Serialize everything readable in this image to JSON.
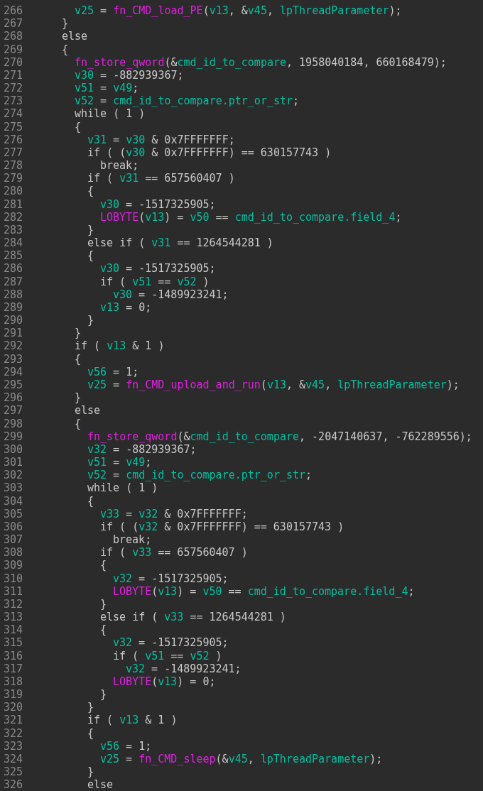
{
  "code_view": {
    "continued_block_lines": [
      {
        "number": "266",
        "tokens": [
          {
            "kind": "var",
            "text": "v25"
          },
          {
            "kind": "plain",
            "text": " = "
          },
          {
            "kind": "func",
            "text": "fn_CMD_load_PE"
          },
          {
            "kind": "plain",
            "text": "("
          },
          {
            "kind": "var",
            "text": "v13"
          },
          {
            "kind": "plain",
            "text": ", &"
          },
          {
            "kind": "var",
            "text": "v45"
          },
          {
            "kind": "plain",
            "text": ", "
          },
          {
            "kind": "var",
            "text": "lpThreadParameter"
          },
          {
            "kind": "plain",
            "text": ");"
          }
        ]
      }
    ],
    "lines": [
      {
        "number": "267",
        "tokens": [
          {
            "kind": "plain",
            "text": "}"
          }
        ]
      },
      {
        "number": "268",
        "tokens": [
          {
            "kind": "plain",
            "text": "else"
          }
        ]
      },
      {
        "number": "269",
        "tokens": [
          {
            "kind": "plain",
            "text": "{"
          }
        ],
        "children": [
          {
            "number": "270",
            "tokens": [
              {
                "kind": "func",
                "text": "fn_store_qword"
              },
              {
                "kind": "plain",
                "text": "(&"
              },
              {
                "kind": "var",
                "text": "cmd_id_to_compare"
              },
              {
                "kind": "plain",
                "text": ", 1958040184, 660168479);"
              }
            ]
          },
          {
            "number": "271",
            "tokens": [
              {
                "kind": "var",
                "text": "v30"
              },
              {
                "kind": "plain",
                "text": " = -882939367;"
              }
            ]
          },
          {
            "number": "272",
            "tokens": [
              {
                "kind": "var",
                "text": "v51"
              },
              {
                "kind": "plain",
                "text": " = "
              },
              {
                "kind": "var",
                "text": "v49"
              },
              {
                "kind": "plain",
                "text": ";"
              }
            ]
          },
          {
            "number": "273",
            "tokens": [
              {
                "kind": "var",
                "text": "v52"
              },
              {
                "kind": "plain",
                "text": " = "
              },
              {
                "kind": "var",
                "text": "cmd_id_to_compare.ptr_or_str"
              },
              {
                "kind": "plain",
                "text": ";"
              }
            ]
          },
          {
            "number": "274",
            "tokens": [
              {
                "kind": "plain",
                "text": "while ( 1 )"
              }
            ]
          },
          {
            "number": "275",
            "tokens": [
              {
                "kind": "plain",
                "text": "{"
              }
            ],
            "children": [
              {
                "number": "276",
                "tokens": [
                  {
                    "kind": "var",
                    "text": "v31"
                  },
                  {
                    "kind": "plain",
                    "text": " = "
                  },
                  {
                    "kind": "var",
                    "text": "v30"
                  },
                  {
                    "kind": "plain",
                    "text": " & 0x7FFFFFFF;"
                  }
                ]
              },
              {
                "number": "277",
                "tokens": [
                  {
                    "kind": "plain",
                    "text": "if ( ("
                  },
                  {
                    "kind": "var",
                    "text": "v30"
                  },
                  {
                    "kind": "plain",
                    "text": " & 0x7FFFFFFF) == 630157743 )"
                  }
                ],
                "children": [
                  {
                    "number": "278",
                    "tokens": [
                      {
                        "kind": "plain",
                        "text": "break;"
                      }
                    ]
                  }
                ]
              },
              {
                "number": "279",
                "tokens": [
                  {
                    "kind": "plain",
                    "text": "if ( "
                  },
                  {
                    "kind": "var",
                    "text": "v31"
                  },
                  {
                    "kind": "plain",
                    "text": " == 657560407 )"
                  }
                ]
              },
              {
                "number": "280",
                "tokens": [
                  {
                    "kind": "plain",
                    "text": "{"
                  }
                ],
                "children": [
                  {
                    "number": "281",
                    "tokens": [
                      {
                        "kind": "var",
                        "text": "v30"
                      },
                      {
                        "kind": "plain",
                        "text": " = -1517325905;"
                      }
                    ]
                  },
                  {
                    "number": "282",
                    "tokens": [
                      {
                        "kind": "func",
                        "text": "LOBYTE"
                      },
                      {
                        "kind": "plain",
                        "text": "("
                      },
                      {
                        "kind": "var",
                        "text": "v13"
                      },
                      {
                        "kind": "plain",
                        "text": ") = "
                      },
                      {
                        "kind": "var",
                        "text": "v50"
                      },
                      {
                        "kind": "plain",
                        "text": " == "
                      },
                      {
                        "kind": "var",
                        "text": "cmd_id_to_compare.field_4"
                      },
                      {
                        "kind": "plain",
                        "text": ";"
                      }
                    ]
                  }
                ]
              },
              {
                "number": "283",
                "tokens": [
                  {
                    "kind": "plain",
                    "text": "}"
                  }
                ]
              },
              {
                "number": "284",
                "tokens": [
                  {
                    "kind": "plain",
                    "text": "else if ( "
                  },
                  {
                    "kind": "var",
                    "text": "v31"
                  },
                  {
                    "kind": "plain",
                    "text": " == 1264544281 )"
                  }
                ]
              },
              {
                "number": "285",
                "tokens": [
                  {
                    "kind": "plain",
                    "text": "{"
                  }
                ],
                "children": [
                  {
                    "number": "286",
                    "tokens": [
                      {
                        "kind": "var",
                        "text": "v30"
                      },
                      {
                        "kind": "plain",
                        "text": " = -1517325905;"
                      }
                    ]
                  },
                  {
                    "number": "287",
                    "tokens": [
                      {
                        "kind": "plain",
                        "text": "if ( "
                      },
                      {
                        "kind": "var",
                        "text": "v51"
                      },
                      {
                        "kind": "plain",
                        "text": " == "
                      },
                      {
                        "kind": "var",
                        "text": "v52"
                      },
                      {
                        "kind": "plain",
                        "text": " )"
                      }
                    ],
                    "children": [
                      {
                        "number": "288",
                        "tokens": [
                          {
                            "kind": "var",
                            "text": "v30"
                          },
                          {
                            "kind": "plain",
                            "text": " = -1489923241;"
                          }
                        ]
                      }
                    ]
                  },
                  {
                    "number": "289",
                    "tokens": [
                      {
                        "kind": "var",
                        "text": "v13"
                      },
                      {
                        "kind": "plain",
                        "text": " = 0;"
                      }
                    ]
                  }
                ]
              },
              {
                "number": "290",
                "tokens": [
                  {
                    "kind": "plain",
                    "text": "}"
                  }
                ]
              }
            ]
          },
          {
            "number": "291",
            "tokens": [
              {
                "kind": "plain",
                "text": "}"
              }
            ]
          },
          {
            "number": "292",
            "tokens": [
              {
                "kind": "plain",
                "text": "if ( "
              },
              {
                "kind": "var",
                "text": "v13"
              },
              {
                "kind": "plain",
                "text": " & 1 )"
              }
            ]
          },
          {
            "number": "293",
            "tokens": [
              {
                "kind": "plain",
                "text": "{"
              }
            ],
            "children": [
              {
                "number": "294",
                "tokens": [
                  {
                    "kind": "var",
                    "text": "v56"
                  },
                  {
                    "kind": "plain",
                    "text": " = 1;"
                  }
                ]
              },
              {
                "number": "295",
                "tokens": [
                  {
                    "kind": "var",
                    "text": "v25"
                  },
                  {
                    "kind": "plain",
                    "text": " = "
                  },
                  {
                    "kind": "func",
                    "text": "fn_CMD_upload_and_run"
                  },
                  {
                    "kind": "plain",
                    "text": "("
                  },
                  {
                    "kind": "var",
                    "text": "v13"
                  },
                  {
                    "kind": "plain",
                    "text": ", &"
                  },
                  {
                    "kind": "var",
                    "text": "v45"
                  },
                  {
                    "kind": "plain",
                    "text": ", "
                  },
                  {
                    "kind": "var",
                    "text": "lpThreadParameter"
                  },
                  {
                    "kind": "plain",
                    "text": ");"
                  }
                ]
              }
            ]
          },
          {
            "number": "296",
            "tokens": [
              {
                "kind": "plain",
                "text": "}"
              }
            ]
          },
          {
            "number": "297",
            "tokens": [
              {
                "kind": "plain",
                "text": "else"
              }
            ]
          },
          {
            "number": "298",
            "tokens": [
              {
                "kind": "plain",
                "text": "{"
              }
            ],
            "children": [
              {
                "number": "299",
                "tokens": [
                  {
                    "kind": "func",
                    "text": "fn_store_qword"
                  },
                  {
                    "kind": "plain",
                    "text": "(&"
                  },
                  {
                    "kind": "var",
                    "text": "cmd_id_to_compare"
                  },
                  {
                    "kind": "plain",
                    "text": ", -2047140637, -762289556);"
                  }
                ]
              },
              {
                "number": "300",
                "tokens": [
                  {
                    "kind": "var",
                    "text": "v32"
                  },
                  {
                    "kind": "plain",
                    "text": " = -882939367;"
                  }
                ]
              },
              {
                "number": "301",
                "tokens": [
                  {
                    "kind": "var",
                    "text": "v51"
                  },
                  {
                    "kind": "plain",
                    "text": " = "
                  },
                  {
                    "kind": "var",
                    "text": "v49"
                  },
                  {
                    "kind": "plain",
                    "text": ";"
                  }
                ]
              },
              {
                "number": "302",
                "tokens": [
                  {
                    "kind": "var",
                    "text": "v52"
                  },
                  {
                    "kind": "plain",
                    "text": " = "
                  },
                  {
                    "kind": "var",
                    "text": "cmd_id_to_compare.ptr_or_str"
                  },
                  {
                    "kind": "plain",
                    "text": ";"
                  }
                ]
              },
              {
                "number": "303",
                "tokens": [
                  {
                    "kind": "plain",
                    "text": "while ( 1 )"
                  }
                ]
              },
              {
                "number": "304",
                "tokens": [
                  {
                    "kind": "plain",
                    "text": "{"
                  }
                ],
                "children": [
                  {
                    "number": "305",
                    "tokens": [
                      {
                        "kind": "var",
                        "text": "v33"
                      },
                      {
                        "kind": "plain",
                        "text": " = "
                      },
                      {
                        "kind": "var",
                        "text": "v32"
                      },
                      {
                        "kind": "plain",
                        "text": " & 0x7FFFFFFF;"
                      }
                    ]
                  },
                  {
                    "number": "306",
                    "tokens": [
                      {
                        "kind": "plain",
                        "text": "if ( ("
                      },
                      {
                        "kind": "var",
                        "text": "v32"
                      },
                      {
                        "kind": "plain",
                        "text": " & 0x7FFFFFFF) == 630157743 )"
                      }
                    ],
                    "children": [
                      {
                        "number": "307",
                        "tokens": [
                          {
                            "kind": "plain",
                            "text": "break;"
                          }
                        ]
                      }
                    ]
                  },
                  {
                    "number": "308",
                    "tokens": [
                      {
                        "kind": "plain",
                        "text": "if ( "
                      },
                      {
                        "kind": "var",
                        "text": "v33"
                      },
                      {
                        "kind": "plain",
                        "text": " == 657560407 )"
                      }
                    ]
                  },
                  {
                    "number": "309",
                    "tokens": [
                      {
                        "kind": "plain",
                        "text": "{"
                      }
                    ],
                    "children": [
                      {
                        "number": "310",
                        "tokens": [
                          {
                            "kind": "var",
                            "text": "v32"
                          },
                          {
                            "kind": "plain",
                            "text": " = -1517325905;"
                          }
                        ]
                      },
                      {
                        "number": "311",
                        "tokens": [
                          {
                            "kind": "func",
                            "text": "LOBYTE"
                          },
                          {
                            "kind": "plain",
                            "text": "("
                          },
                          {
                            "kind": "var",
                            "text": "v13"
                          },
                          {
                            "kind": "plain",
                            "text": ") = "
                          },
                          {
                            "kind": "var",
                            "text": "v50"
                          },
                          {
                            "kind": "plain",
                            "text": " == "
                          },
                          {
                            "kind": "var",
                            "text": "cmd_id_to_compare.field_4"
                          },
                          {
                            "kind": "plain",
                            "text": ";"
                          }
                        ]
                      }
                    ]
                  },
                  {
                    "number": "312",
                    "tokens": [
                      {
                        "kind": "plain",
                        "text": "}"
                      }
                    ]
                  },
                  {
                    "number": "313",
                    "tokens": [
                      {
                        "kind": "plain",
                        "text": "else if ( "
                      },
                      {
                        "kind": "var",
                        "text": "v33"
                      },
                      {
                        "kind": "plain",
                        "text": " == 1264544281 )"
                      }
                    ]
                  },
                  {
                    "number": "314",
                    "tokens": [
                      {
                        "kind": "plain",
                        "text": "{"
                      }
                    ],
                    "children": [
                      {
                        "number": "315",
                        "tokens": [
                          {
                            "kind": "var",
                            "text": "v32"
                          },
                          {
                            "kind": "plain",
                            "text": " = -1517325905;"
                          }
                        ]
                      },
                      {
                        "number": "316",
                        "tokens": [
                          {
                            "kind": "plain",
                            "text": "if ( "
                          },
                          {
                            "kind": "var",
                            "text": "v51"
                          },
                          {
                            "kind": "plain",
                            "text": " == "
                          },
                          {
                            "kind": "var",
                            "text": "v52"
                          },
                          {
                            "kind": "plain",
                            "text": " )"
                          }
                        ],
                        "children": [
                          {
                            "number": "317",
                            "tokens": [
                              {
                                "kind": "var",
                                "text": "v32"
                              },
                              {
                                "kind": "plain",
                                "text": " = -1489923241;"
                              }
                            ]
                          }
                        ]
                      },
                      {
                        "number": "318",
                        "tokens": [
                          {
                            "kind": "func",
                            "text": "LOBYTE"
                          },
                          {
                            "kind": "plain",
                            "text": "("
                          },
                          {
                            "kind": "var",
                            "text": "v13"
                          },
                          {
                            "kind": "plain",
                            "text": ") = 0;"
                          }
                        ]
                      }
                    ]
                  },
                  {
                    "number": "319",
                    "tokens": [
                      {
                        "kind": "plain",
                        "text": "}"
                      }
                    ]
                  }
                ]
              },
              {
                "number": "320",
                "tokens": [
                  {
                    "kind": "plain",
                    "text": "}"
                  }
                ]
              },
              {
                "number": "321",
                "tokens": [
                  {
                    "kind": "plain",
                    "text": "if ( "
                  },
                  {
                    "kind": "var",
                    "text": "v13"
                  },
                  {
                    "kind": "plain",
                    "text": " & 1 )"
                  }
                ]
              },
              {
                "number": "322",
                "tokens": [
                  {
                    "kind": "plain",
                    "text": "{"
                  }
                ],
                "children": [
                  {
                    "number": "323",
                    "tokens": [
                      {
                        "kind": "var",
                        "text": "v56"
                      },
                      {
                        "kind": "plain",
                        "text": " = 1;"
                      }
                    ]
                  },
                  {
                    "number": "324",
                    "tokens": [
                      {
                        "kind": "var",
                        "text": "v25"
                      },
                      {
                        "kind": "plain",
                        "text": " = "
                      },
                      {
                        "kind": "func",
                        "text": "fn_CMD_sleep"
                      },
                      {
                        "kind": "plain",
                        "text": "(&"
                      },
                      {
                        "kind": "var",
                        "text": "v45"
                      },
                      {
                        "kind": "plain",
                        "text": ", "
                      },
                      {
                        "kind": "var",
                        "text": "lpThreadParameter"
                      },
                      {
                        "kind": "plain",
                        "text": ");"
                      }
                    ]
                  }
                ]
              },
              {
                "number": "325",
                "tokens": [
                  {
                    "kind": "plain",
                    "text": "}"
                  }
                ]
              },
              {
                "number": "326",
                "tokens": [
                  {
                    "kind": "plain",
                    "text": "else"
                  }
                ]
              }
            ]
          }
        ]
      }
    ]
  }
}
